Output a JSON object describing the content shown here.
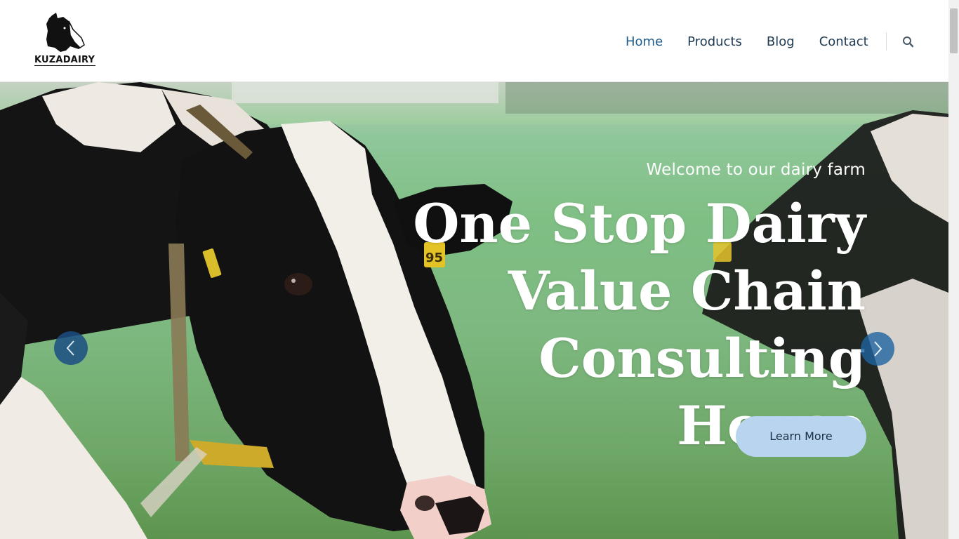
{
  "header": {
    "logo_text": "KUZADAIRY",
    "nav": [
      {
        "label": "Home",
        "active": true
      },
      {
        "label": "Products",
        "active": false
      },
      {
        "label": "Blog",
        "active": false
      },
      {
        "label": "Contact",
        "active": false
      }
    ],
    "search_icon": "search-icon"
  },
  "hero": {
    "subtitle": "Welcome to our dairy farm",
    "title_lines": [
      "One Stop Dairy",
      "Value Chain",
      "Consulting",
      "House"
    ],
    "cta_label": "Learn More",
    "ear_tag_number": "95",
    "prev_icon": "chevron-left-icon",
    "next_icon": "chevron-right-icon"
  },
  "colors": {
    "nav_active": "#1e5b8a",
    "nav_text": "#1d3a52",
    "cta_bg": "#b8d4ee",
    "arrow_bg": "#1b4e82"
  }
}
